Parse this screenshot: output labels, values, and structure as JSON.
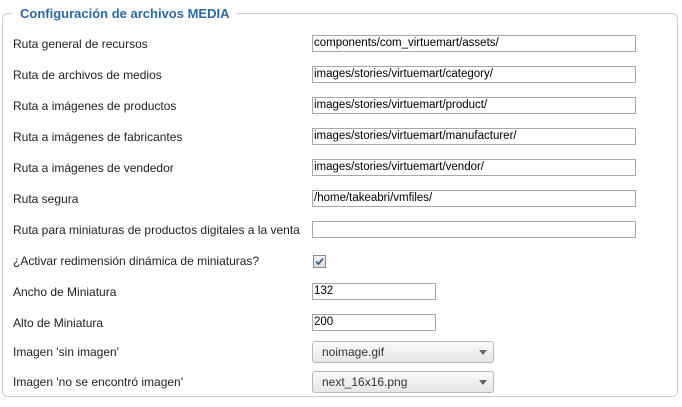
{
  "fieldset": {
    "legend": "Configuración de archivos MEDIA"
  },
  "fields": [
    {
      "label": "Ruta general de recursos",
      "type": "text",
      "value": "components/com_virtuemart/assets/"
    },
    {
      "label": "Ruta de archivos de medios",
      "type": "text",
      "value": "images/stories/virtuemart/category/"
    },
    {
      "label": "Ruta a imágenes de productos",
      "type": "text",
      "value": "images/stories/virtuemart/product/"
    },
    {
      "label": "Ruta a imágenes de fabricantes",
      "type": "text",
      "value": "images/stories/virtuemart/manufacturer/"
    },
    {
      "label": "Ruta a imágenes de vendedor",
      "type": "text",
      "value": "images/stories/virtuemart/vendor/"
    },
    {
      "label": "Ruta segura",
      "type": "text",
      "value": "/home/takeabri/vmfiles/"
    },
    {
      "label": "Ruta para miniaturas de productos digitales a la venta",
      "type": "text",
      "value": ""
    },
    {
      "label": "¿Activar redimensión dinámica de miniaturas?",
      "type": "checkbox",
      "checked": true
    },
    {
      "label": "Ancho de Miniatura",
      "type": "text",
      "value": "132"
    },
    {
      "label": "Alto de Miniatura",
      "type": "text",
      "value": "200"
    },
    {
      "label": "Imagen 'sin imagen'",
      "type": "select",
      "selected": "noimage.gif"
    },
    {
      "label": "Imagen 'no se encontró imagen'",
      "type": "select",
      "selected": "next_16x16.png"
    }
  ],
  "colors": {
    "legend": "#2a6aa6",
    "border": "#cccccc"
  }
}
